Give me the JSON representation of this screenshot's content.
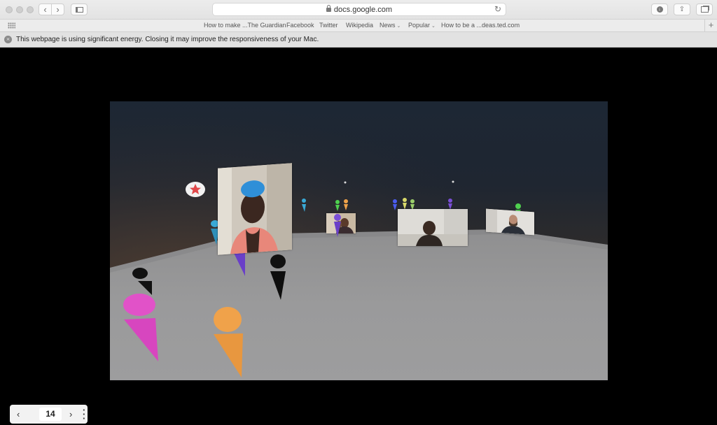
{
  "browser": {
    "address": "docs.google.com",
    "favorites": [
      {
        "label": "How to make ...The Guardian",
        "has_menu": false
      },
      {
        "label": "Facebook",
        "has_menu": false
      },
      {
        "label": "Twitter",
        "has_menu": false
      },
      {
        "label": "Wikipedia",
        "has_menu": false
      },
      {
        "label": "News",
        "has_menu": true
      },
      {
        "label": "Popular",
        "has_menu": true
      },
      {
        "label": "How to be a ...deas.ted.com",
        "has_menu": false
      }
    ],
    "energy_warning": "This webpage is using significant energy. Closing it may improve the responsiveness of your Mac."
  },
  "scene": {
    "avatar_colors": {
      "pink": "#e152c8",
      "orange": "#f0a24a",
      "purple": "#7b4fd8",
      "black": "#111111",
      "cyan": "#39a9d6",
      "green": "#4fd14f",
      "blue": "#4a5cf0"
    },
    "favorite_marker": "star-icon"
  },
  "pager": {
    "page": "14",
    "prev_icon": "chevron-left-icon",
    "next_icon": "chevron-right-icon",
    "more_icon": "more-vertical-icon"
  }
}
